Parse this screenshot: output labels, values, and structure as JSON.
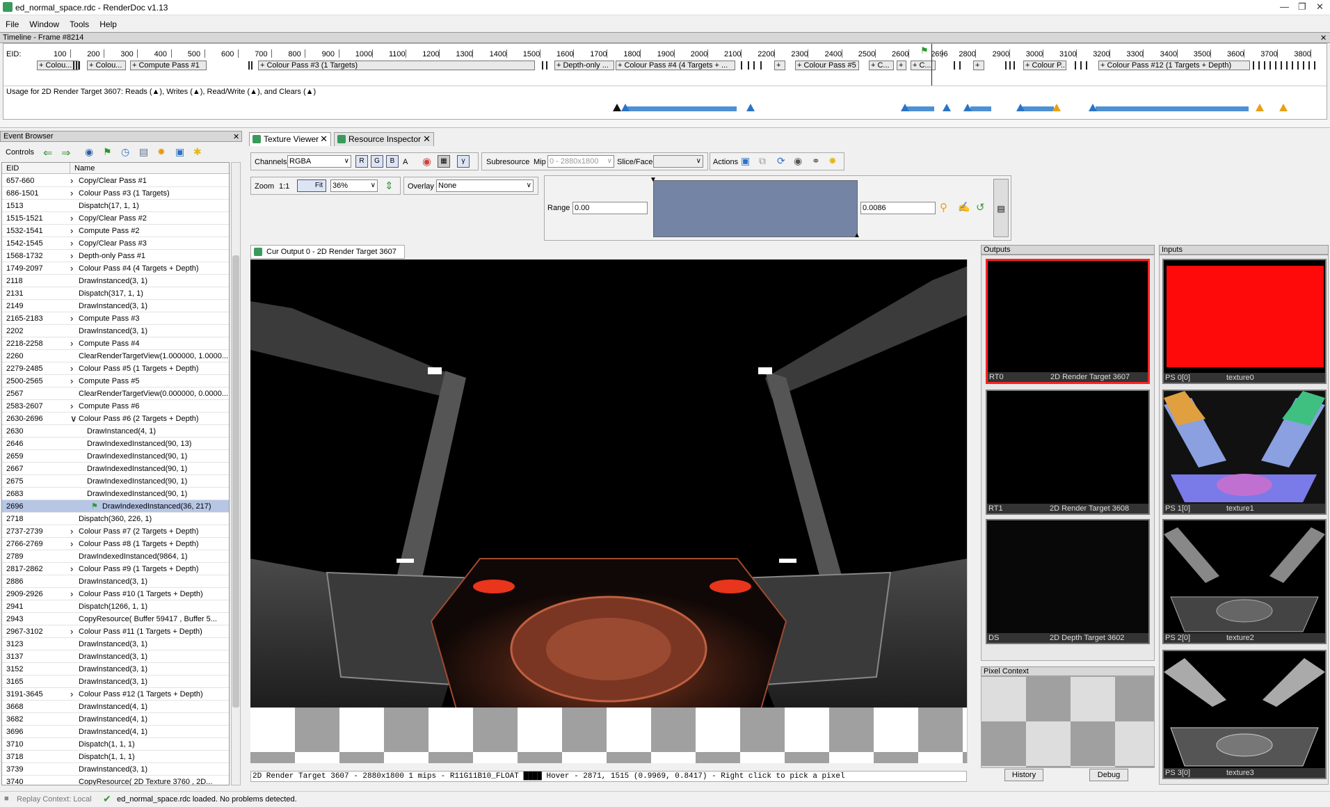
{
  "window": {
    "title": "ed_normal_space.rdc - RenderDoc v1.13"
  },
  "menu": [
    "File",
    "Window",
    "Tools",
    "Help"
  ],
  "timeline": {
    "header": "Timeline - Frame #8214",
    "eid_label": "EID:",
    "ticks": [
      "100",
      "200",
      "300",
      "400",
      "500",
      "600",
      "700",
      "800",
      "900",
      "1000",
      "1100",
      "1200",
      "1300",
      "1400",
      "1500",
      "1600",
      "1700",
      "1800",
      "1900",
      "2000",
      "2100",
      "2200",
      "2300",
      "2400",
      "2500",
      "2600",
      "2696",
      "2800",
      "2900",
      "3000",
      "3100",
      "3200",
      "3300",
      "3400",
      "3500",
      "3600",
      "3700",
      "3800"
    ],
    "passes": [
      "+ Colou...",
      "+ Colou...",
      "+ Compute Pass #1",
      "+ Colour Pass #3 (1 Targets)",
      "+ Depth-only ...",
      "+ Colour Pass #4 (4 Targets + ...",
      "+",
      "+ Colour Pass #5",
      "+ C...",
      "+",
      "+ C...",
      "+",
      "+ Colour P...",
      "+ Colour Pass #12 (1 Targets + Depth)"
    ],
    "usage": "Usage for 2D Render Target 3607: Reads (▲), Writes (▲), Read/Write (▲), and Clears (▲)"
  },
  "event_browser": {
    "title": "Event Browser",
    "controls_label": "Controls",
    "columns": [
      "EID",
      "Name"
    ],
    "rows": [
      [
        "657-660",
        "Copy/Clear Pass #1",
        1,
        0
      ],
      [
        "686-1501",
        "Colour Pass #3 (1 Targets)",
        1,
        0
      ],
      [
        "1513",
        "Dispatch(17, 1, 1)",
        0,
        0
      ],
      [
        "1515-1521",
        "Copy/Clear Pass #2",
        1,
        0
      ],
      [
        "1532-1541",
        "Compute Pass #2",
        1,
        0
      ],
      [
        "1542-1545",
        "Copy/Clear Pass #3",
        1,
        0
      ],
      [
        "1568-1732",
        "Depth-only Pass #1",
        1,
        0
      ],
      [
        "1749-2097",
        "Colour Pass #4 (4 Targets + Depth)",
        1,
        0
      ],
      [
        "2118",
        "DrawInstanced(3, 1)",
        0,
        0
      ],
      [
        "2131",
        "Dispatch(317, 1, 1)",
        0,
        0
      ],
      [
        "2149",
        "DrawInstanced(3, 1)",
        0,
        0
      ],
      [
        "2165-2183",
        "Compute Pass #3",
        1,
        0
      ],
      [
        "2202",
        "DrawInstanced(3, 1)",
        0,
        0
      ],
      [
        "2218-2258",
        "Compute Pass #4",
        1,
        0
      ],
      [
        "2260",
        "ClearRenderTargetView(1.000000, 1.0000...",
        0,
        0
      ],
      [
        "2279-2485",
        "Colour Pass #5 (1 Targets + Depth)",
        1,
        0
      ],
      [
        "2500-2565",
        "Compute Pass #5",
        1,
        0
      ],
      [
        "2567",
        "ClearRenderTargetView(0.000000, 0.0000...",
        0,
        0
      ],
      [
        "2583-2607",
        "Compute Pass #6",
        1,
        0
      ],
      [
        "2630-2696",
        "Colour Pass #6 (2 Targets + Depth)",
        2,
        0
      ],
      [
        "2630",
        "DrawInstanced(4, 1)",
        0,
        1
      ],
      [
        "2646",
        "DrawIndexedInstanced(90, 13)",
        0,
        1
      ],
      [
        "2659",
        "DrawIndexedInstanced(90, 1)",
        0,
        1
      ],
      [
        "2667",
        "DrawIndexedInstanced(90, 1)",
        0,
        1
      ],
      [
        "2675",
        "DrawIndexedInstanced(90, 1)",
        0,
        1
      ],
      [
        "2683",
        "DrawIndexedInstanced(90, 1)",
        0,
        1
      ],
      [
        "2696",
        "DrawIndexedInstanced(36, 217)",
        0,
        2
      ],
      [
        "2718",
        "Dispatch(360, 226, 1)",
        0,
        0
      ],
      [
        "2737-2739",
        "Colour Pass #7 (2 Targets + Depth)",
        1,
        0
      ],
      [
        "2766-2769",
        "Colour Pass #8 (1 Targets + Depth)",
        1,
        0
      ],
      [
        "2789",
        "DrawIndexedInstanced(9864, 1)",
        0,
        0
      ],
      [
        "2817-2862",
        "Colour Pass #9 (1 Targets + Depth)",
        1,
        0
      ],
      [
        "2886",
        "DrawInstanced(3, 1)",
        0,
        0
      ],
      [
        "2909-2926",
        "Colour Pass #10 (1 Targets + Depth)",
        1,
        0
      ],
      [
        "2941",
        "Dispatch(1266, 1, 1)",
        0,
        0
      ],
      [
        "2943",
        "CopyResource( Buffer 59417 , Buffer 5...",
        0,
        0
      ],
      [
        "2967-3102",
        "Colour Pass #11 (1 Targets + Depth)",
        1,
        0
      ],
      [
        "3123",
        "DrawInstanced(3, 1)",
        0,
        0
      ],
      [
        "3137",
        "DrawInstanced(3, 1)",
        0,
        0
      ],
      [
        "3152",
        "DrawInstanced(3, 1)",
        0,
        0
      ],
      [
        "3165",
        "DrawInstanced(3, 1)",
        0,
        0
      ],
      [
        "3191-3645",
        "Colour Pass #12 (1 Targets + Depth)",
        1,
        0
      ],
      [
        "3668",
        "DrawInstanced(4, 1)",
        0,
        0
      ],
      [
        "3682",
        "DrawInstanced(4, 1)",
        0,
        0
      ],
      [
        "3696",
        "DrawInstanced(4, 1)",
        0,
        0
      ],
      [
        "3710",
        "Dispatch(1, 1, 1)",
        0,
        0
      ],
      [
        "3718",
        "Dispatch(1, 1, 1)",
        0,
        0
      ],
      [
        "3739",
        "DrawInstanced(3, 1)",
        0,
        0
      ],
      [
        "3740",
        "CopyResource( 2D Texture 3760 , 2D...",
        0,
        0
      ]
    ]
  },
  "tabs": {
    "texture_viewer": "Texture Viewer",
    "resource_inspector": "Resource Inspector"
  },
  "toolbar": {
    "channels_label": "Channels",
    "channels_value": "RGBA",
    "ch_r": "R",
    "ch_g": "G",
    "ch_b": "B",
    "ch_a": "A",
    "subresource_label": "Subresource",
    "mip_label": "Mip",
    "mip_value": "0 - 2880x1800",
    "slice_label": "Slice/Face",
    "actions_label": "Actions",
    "zoom_label": "Zoom",
    "zoom_11": "1:1",
    "fit_label": "Fit",
    "zoom_value": "36%",
    "overlay_label": "Overlay",
    "overlay_value": "None",
    "range_label": "Range",
    "range_min": "0.00",
    "range_max": "0.0086"
  },
  "viewer": {
    "cur_output_tab": "Cur Output 0 - 2D Render Target 3607",
    "status": "2D Render Target 3607 - 2880x1800 1 mips - R11G11B10_FLOAT ████ Hover -  2871, 1515 (0.9969, 0.8417)  - Right click to pick a pixel"
  },
  "outputs": {
    "title": "Outputs",
    "items": [
      {
        "slot": "RT0",
        "name": "2D Render Target 3607"
      },
      {
        "slot": "RT1",
        "name": "2D Render Target 3608"
      },
      {
        "slot": "DS",
        "name": "2D Depth Target 3602"
      }
    ]
  },
  "inputs": {
    "title": "Inputs",
    "items": [
      {
        "slot": "PS 0[0]",
        "name": "texture0"
      },
      {
        "slot": "PS 1[0]",
        "name": "texture1"
      },
      {
        "slot": "PS 2[0]",
        "name": "texture2"
      },
      {
        "slot": "PS 3[0]",
        "name": "texture3"
      }
    ]
  },
  "pixel_context": {
    "title": "Pixel Context",
    "history": "History",
    "debug": "Debug"
  },
  "statusbar": {
    "replay": "Replay Context: Local",
    "message": "ed_normal_space.rdc loaded. No problems detected."
  },
  "colors": {
    "selected_output": "#ff2222",
    "accent_blue": "#2b74c4"
  }
}
